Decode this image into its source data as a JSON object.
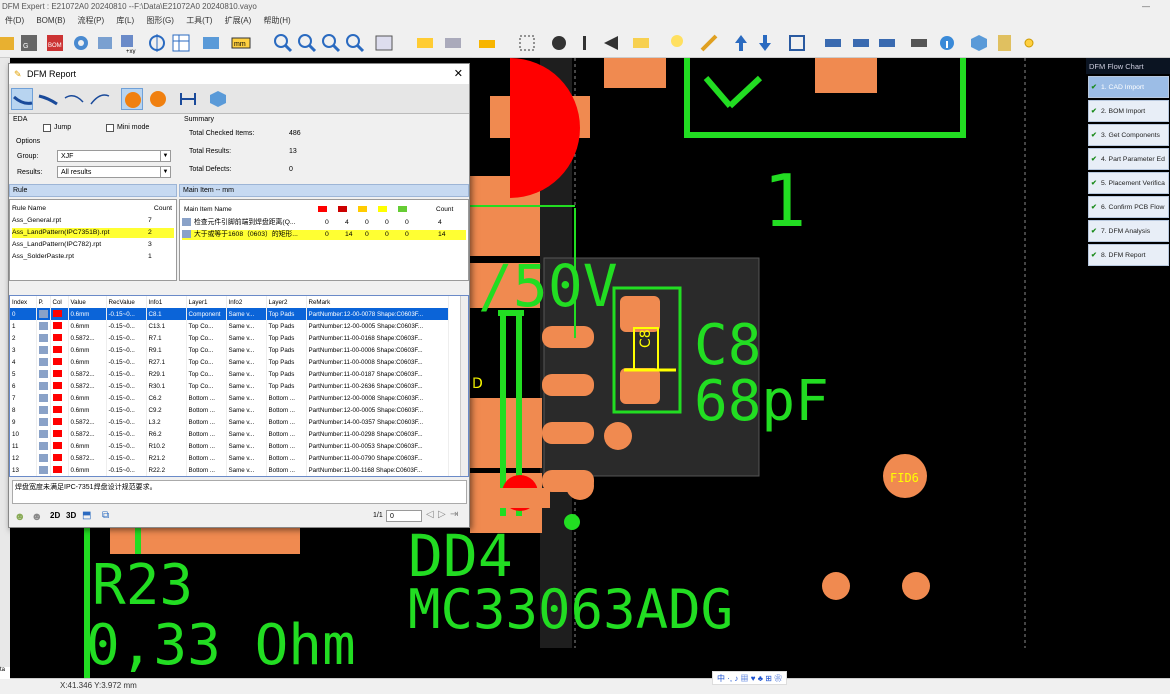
{
  "app": {
    "title": "DFM Expert : E21072A0 20240810  --F:\\Data\\E21072A0 20240810.vayo",
    "minimize": "—"
  },
  "menu": [
    "件(D)",
    "BOM(B)",
    "流程(P)",
    "库(L)",
    "图形(G)",
    "工具(T)",
    "扩展(A)",
    "帮助(H)"
  ],
  "canvas_labels": {
    "v": "/50V",
    "c8_ref": "C8",
    "c8_val": "68pF",
    "c8_small": "C8",
    "one": "1",
    "fid": "FID6",
    "dd4": "DD4",
    "mc": "MC33063ADG",
    "r23": "R23",
    "ohm": "0,33 Ohm",
    "d_small": "D"
  },
  "flow": {
    "title": "DFM Flow Chart",
    "items": [
      "1. CAD Import",
      "2. BOM Import",
      "3. Get Components",
      "4. Part Parameter Ed",
      "5. Placement Verifica",
      "6. Confirm PCB Flow",
      "7. DFM Analysis",
      "8. DFM Report"
    ]
  },
  "status": {
    "coord": "X:41.346 Y:3.972 mm",
    "left": "ta",
    "ime": "中 ·, ♪ ▦ ♥ ♣ ⊞ ❀"
  },
  "dialog": {
    "title": "DFM Report",
    "eda": {
      "label": "EDA",
      "jump": "Jump",
      "mini": "Mini mode"
    },
    "options": {
      "label": "Options",
      "group_label": "Group:",
      "group_value": "XJF",
      "results_label": "Results:",
      "results_value": "All results"
    },
    "summary": {
      "label": "Summary",
      "checked_label": "Total Checked Items:",
      "checked": "486",
      "results_label": "Total Results:",
      "results": "13",
      "defects_label": "Total Defects:",
      "defects": "0"
    },
    "rule": {
      "bar": "Rule",
      "col_name": "Rule Name",
      "col_count": "Count",
      "rows": [
        {
          "name": "Ass_General.rpt",
          "count": "7"
        },
        {
          "name": "Ass_LandPattern(IPC7351B).rpt",
          "count": "2"
        },
        {
          "name": "Ass_LandPattern(IPC782).rpt",
          "count": "3"
        },
        {
          "name": "Ass_SolderPaste.rpt",
          "count": "1"
        }
      ]
    },
    "main": {
      "bar": "Main Item -- mm",
      "col_name": "Main Item Name",
      "col_count": "Count",
      "swatches": [
        "#ff0000",
        "#cc0000",
        "#ffcc00",
        "#ffff00",
        "#66cc33"
      ],
      "rows": [
        {
          "name": "检查元件引脚前端到焊盘距离(Q...",
          "vals": [
            "0",
            "4",
            "0",
            "0",
            "0"
          ],
          "count": "4"
        },
        {
          "name": "大于或等于1608（0603）的矩形...",
          "vals": [
            "0",
            "14",
            "0",
            "0",
            "0"
          ],
          "count": "14"
        }
      ]
    },
    "table": {
      "headers": [
        "Index",
        "P.",
        "Col",
        "Value",
        "RecValue",
        "Info1",
        "Layer1",
        "Info2",
        "Layer2",
        "ReMark"
      ],
      "rows": [
        [
          "0",
          "0.6mm",
          "-0.15~0...",
          "C8.1",
          "Component",
          "Same v...",
          "Top Pads",
          "PartNumber:12-00-0078 Shape:C0603F..."
        ],
        [
          "1",
          "0.6mm",
          "-0.15~0...",
          "C13.1",
          "Top Co...",
          "Same v...",
          "Top Pads",
          "PartNumber:12-00-0005 Shape:C0603F..."
        ],
        [
          "2",
          "0.5872...",
          "-0.15~0...",
          "R7.1",
          "Top Co...",
          "Same v...",
          "Top Pads",
          "PartNumber:11-00-0168 Shape:C0603F..."
        ],
        [
          "3",
          "0.6mm",
          "-0.15~0...",
          "R9.1",
          "Top Co...",
          "Same v...",
          "Top Pads",
          "PartNumber:11-00-0006 Shape:C0603F..."
        ],
        [
          "4",
          "0.6mm",
          "-0.15~0...",
          "R27.1",
          "Top Co...",
          "Same v...",
          "Top Pads",
          "PartNumber:11-00-0008 Shape:C0603F..."
        ],
        [
          "5",
          "0.5872...",
          "-0.15~0...",
          "R29.1",
          "Top Co...",
          "Same v...",
          "Top Pads",
          "PartNumber:11-00-0187 Shape:C0603F..."
        ],
        [
          "6",
          "0.5872...",
          "-0.15~0...",
          "R30.1",
          "Top Co...",
          "Same v...",
          "Top Pads",
          "PartNumber:11-00-2636 Shape:C0603F..."
        ],
        [
          "7",
          "0.6mm",
          "-0.15~0...",
          "C6.2",
          "Bottom ...",
          "Same v...",
          "Bottom ...",
          "PartNumber:12-00-0008 Shape:C0603F..."
        ],
        [
          "8",
          "0.6mm",
          "-0.15~0...",
          "C9.2",
          "Bottom ...",
          "Same v...",
          "Bottom ...",
          "PartNumber:12-00-0005 Shape:C0603F..."
        ],
        [
          "9",
          "0.5872...",
          "-0.15~0...",
          "L3.2",
          "Bottom ...",
          "Same v...",
          "Bottom ...",
          "PartNumber:14-00-0357 Shape:C0603F..."
        ],
        [
          "10",
          "0.5872...",
          "-0.15~0...",
          "R6.2",
          "Bottom ...",
          "Same v...",
          "Bottom ...",
          "PartNumber:11-00-0298 Shape:C0603F..."
        ],
        [
          "11",
          "0.6mm",
          "-0.15~0...",
          "R10.2",
          "Bottom ...",
          "Same v...",
          "Bottom ...",
          "PartNumber:11-00-0053 Shape:C0603F..."
        ],
        [
          "12",
          "0.5872...",
          "-0.15~0...",
          "R21.2",
          "Bottom ...",
          "Same v...",
          "Bottom ...",
          "PartNumber:11-00-0790 Shape:C0603F..."
        ],
        [
          "13",
          "0.6mm",
          "-0.15~0...",
          "R22.2",
          "Bottom ...",
          "Same v...",
          "Bottom ...",
          "PartNumber:11-00-1168 Shape:C0603F..."
        ]
      ]
    },
    "message": "焊盘宽度未满足IPC-7351焊盘设计规范要求。",
    "bottom": {
      "b2d": "2D",
      "b3d": "3D",
      "page": "1/1",
      "page_input": "0"
    }
  }
}
